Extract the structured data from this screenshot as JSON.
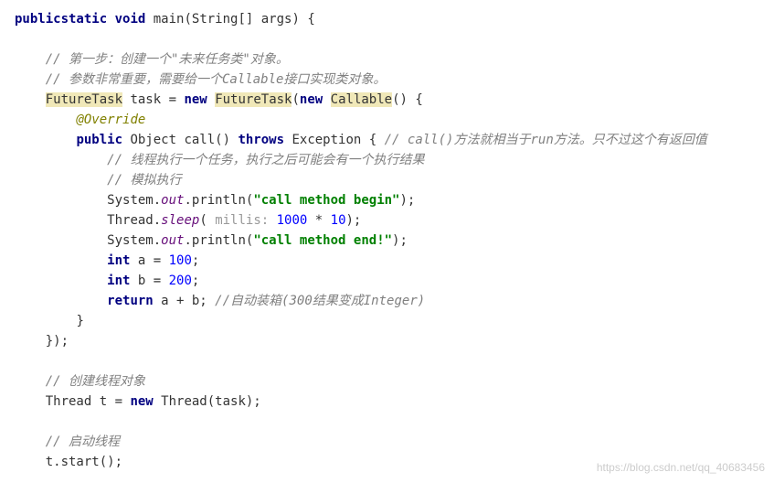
{
  "code": {
    "l1_kw1": "public",
    "l1_kw2": "static",
    "l1_kw3": "void",
    "l1_rest": " main(String[] args) {",
    "blank": "",
    "l3_indent": "    ",
    "l3_comment": "// 第一步：创建一个\"未来任务类\"对象。",
    "l4_indent": "    ",
    "l4_comment": "// 参数非常重要，需要给一个Callable接口实现类对象。",
    "l5_indent": "    ",
    "l5_hl1": "FutureTask",
    "l5_mid": " task = ",
    "l5_kw": "new",
    "l5_sp": " ",
    "l5_hl2": "FutureTask",
    "l5_paren": "(",
    "l5_kw2": "new",
    "l5_sp2": " ",
    "l5_hl3": "Callable",
    "l5_tail": "() {",
    "l6_indent": "        ",
    "l6_ann": "@Override",
    "l7_indent": "        ",
    "l7_kw1": "public",
    "l7_mid1": " Object call() ",
    "l7_kw2": "throws",
    "l7_mid2": " Exception { ",
    "l7_comment": "// call()方法就相当于run方法。只不过这个有返回值",
    "l8_indent": "            ",
    "l8_comment": "// 线程执行一个任务，执行之后可能会有一个执行结果",
    "l9_indent": "            ",
    "l9_comment": "// 模拟执行",
    "l10_indent": "            ",
    "l10_a": "System.",
    "l10_out": "out",
    "l10_b": ".println(",
    "l10_str": "\"call method begin\"",
    "l10_c": ");",
    "l11_indent": "            ",
    "l11_a": "Thread.",
    "l11_sleep": "sleep",
    "l11_b": "( ",
    "l11_hint": "millis: ",
    "l11_num": "1000",
    "l11_c": " * ",
    "l11_num2": "10",
    "l11_d": ");",
    "l12_indent": "            ",
    "l12_a": "System.",
    "l12_out": "out",
    "l12_b": ".println(",
    "l12_str": "\"call method end!\"",
    "l12_c": ");",
    "l13_indent": "            ",
    "l13_kw": "int",
    "l13_a": " a = ",
    "l13_num": "100",
    "l13_b": ";",
    "l14_indent": "            ",
    "l14_kw": "int",
    "l14_a": " b = ",
    "l14_num": "200",
    "l14_b": ";",
    "l15_indent": "            ",
    "l15_kw": "return",
    "l15_a": " a + b; ",
    "l15_comment": "//自动装箱(300结果变成Integer)",
    "l16_indent": "        ",
    "l16_a": "}",
    "l17_indent": "    ",
    "l17_a": "});",
    "l19_indent": "    ",
    "l19_comment": "// 创建线程对象",
    "l20_indent": "    ",
    "l20_a": "Thread t = ",
    "l20_kw": "new",
    "l20_b": " Thread(task);",
    "l22_indent": "    ",
    "l22_comment": "// 启动线程",
    "l23_indent": "    ",
    "l23_a": "t.start();"
  },
  "watermark": "https://blog.csdn.net/qq_40683456"
}
